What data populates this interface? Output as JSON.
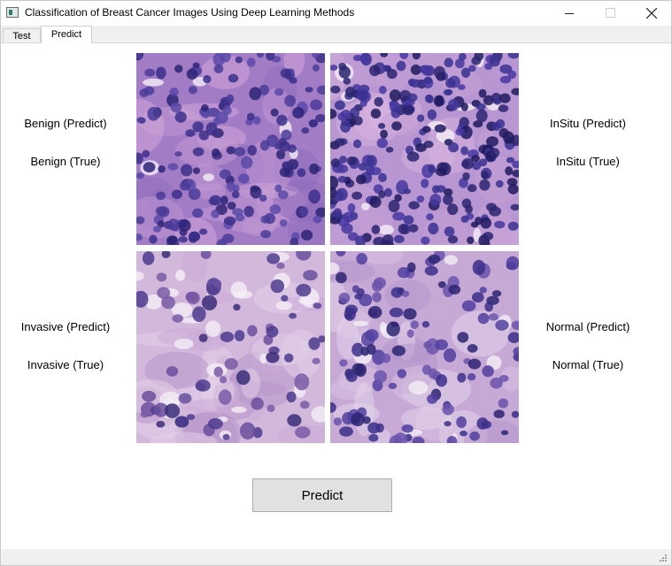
{
  "window": {
    "title": "Classification of Breast Cancer Images Using Deep Learning Methods"
  },
  "tabs": [
    {
      "label": "Test",
      "active": false
    },
    {
      "label": "Predict",
      "active": true
    }
  ],
  "panels": {
    "benign": {
      "predict_label": "Benign (Predict)",
      "true_label": "Benign (True)"
    },
    "insitu": {
      "predict_label": "InSitu (Predict)",
      "true_label": "InSitu (True)"
    },
    "invasive": {
      "predict_label": "Invasive (Predict)",
      "true_label": "Invasive (True)"
    },
    "normal": {
      "predict_label": "Normal (Predict)",
      "true_label": "Normal (True)"
    }
  },
  "predict_button": {
    "label": "Predict"
  },
  "colors": {
    "tissue_pink": "#d3a7d2",
    "nucleus_purple": "#3b2f8a",
    "button_bg": "#e1e1e1"
  }
}
